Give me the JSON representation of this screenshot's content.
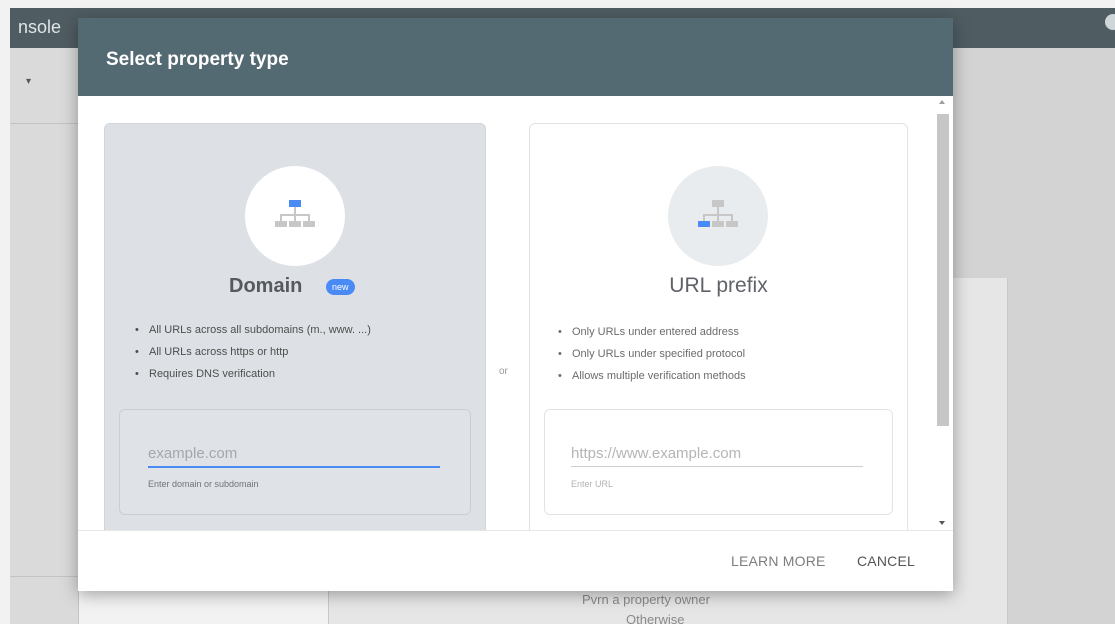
{
  "background": {
    "app_title": "nsole",
    "text_line_1": "Pvrn a property owner",
    "text_line_2": "Otherwise"
  },
  "dialog": {
    "title": "Select property type",
    "or_label": "or",
    "domain": {
      "title": "Domain",
      "badge": "new",
      "bullets": [
        "All URLs across all subdomains (m., www. ...)",
        "All URLs across https or http",
        "Requires DNS verification"
      ],
      "input_placeholder": "example.com",
      "input_value": "",
      "helper": "Enter domain or subdomain"
    },
    "url_prefix": {
      "title": "URL prefix",
      "bullets": [
        "Only URLs under entered address",
        "Only URLs under specified protocol",
        "Allows multiple verification methods"
      ],
      "input_placeholder": "https://www.example.com",
      "input_value": "",
      "helper": "Enter URL"
    },
    "footer": {
      "learn_more": "LEARN MORE",
      "cancel": "CANCEL"
    }
  },
  "colors": {
    "header": "#546a73",
    "accent": "#4a8af4",
    "domain_card": "#dde1e5"
  },
  "icons": {
    "domain": "sitemap-icon",
    "url_prefix": "sitemap-icon"
  }
}
